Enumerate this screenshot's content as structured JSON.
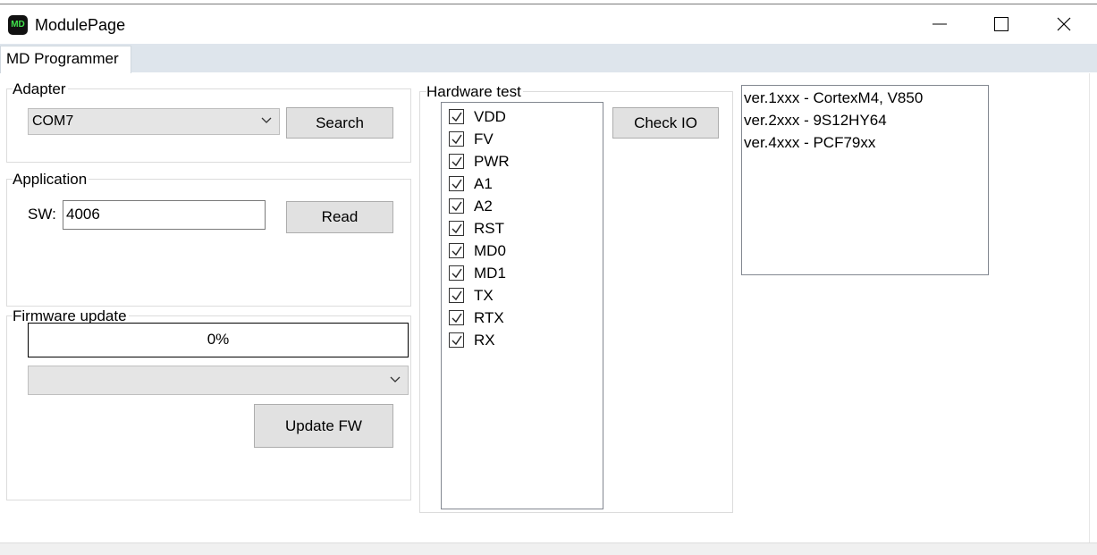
{
  "window": {
    "title": "ModulePage",
    "icon_text": "MD"
  },
  "tabs": [
    {
      "label": "MD Programmer"
    }
  ],
  "adapter": {
    "group_label": "Adapter",
    "port_selected": "COM7",
    "search_label": "Search"
  },
  "application": {
    "group_label": "Application",
    "sw_label": "SW:",
    "sw_value": "4006",
    "read_label": "Read"
  },
  "firmware": {
    "group_label": "Firmware update",
    "progress_text": "0%",
    "progress_fraction": 0.0,
    "file_selected": "",
    "update_label": "Update FW"
  },
  "hardware_test": {
    "group_label": "Hardware test",
    "check_io_label": "Check IO",
    "items": [
      {
        "label": "VDD",
        "checked": true
      },
      {
        "label": "FV",
        "checked": true
      },
      {
        "label": "PWR",
        "checked": true
      },
      {
        "label": "A1",
        "checked": true
      },
      {
        "label": "A2",
        "checked": true
      },
      {
        "label": "RST",
        "checked": true
      },
      {
        "label": "MD0",
        "checked": true
      },
      {
        "label": "MD1",
        "checked": true
      },
      {
        "label": "TX",
        "checked": true
      },
      {
        "label": "RTX",
        "checked": true
      },
      {
        "label": "RX",
        "checked": true
      }
    ]
  },
  "versions": [
    "ver.1xxx - CortexM4, V850",
    "ver.2xxx - 9S12HY64",
    "ver.4xxx - PCF79xx"
  ],
  "colors": {
    "accent_icon": "#3fe04a",
    "tab_strip": "#dee5ec",
    "button": "#e1e1e1"
  }
}
